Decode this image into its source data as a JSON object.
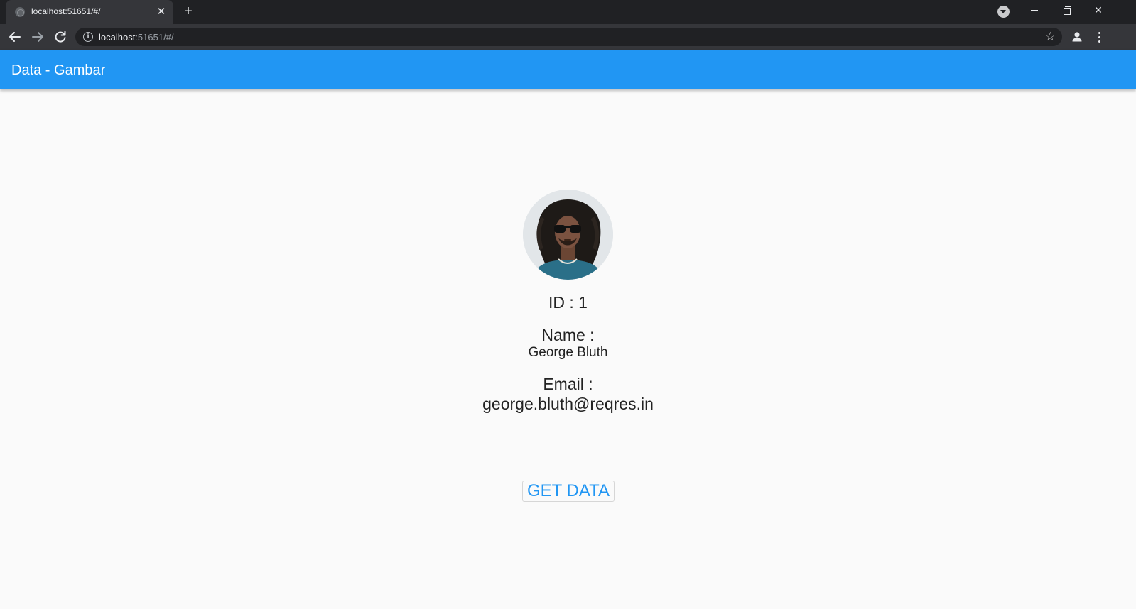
{
  "browser": {
    "tab_title": "localhost:51651/#/",
    "tab_close": "✕",
    "new_tab": "+",
    "url_host": "localhost",
    "url_rest": ":51651/#/",
    "window_close": "✕"
  },
  "appbar": {
    "title": "Data - Gambar",
    "color": "#2196f3"
  },
  "user": {
    "id_label": "ID : 1",
    "name_label": "Name :",
    "name": "George Bluth",
    "email_label": "Email :",
    "email": "george.bluth@reqres.in"
  },
  "actions": {
    "get_data_label": "GET DATA"
  },
  "icons": {
    "back": "arrow-left-icon",
    "forward": "arrow-right-icon",
    "reload": "reload-icon",
    "info": "info-icon",
    "bookmark": "star-icon",
    "profile": "profile-icon",
    "menu": "kebab-menu-icon"
  }
}
